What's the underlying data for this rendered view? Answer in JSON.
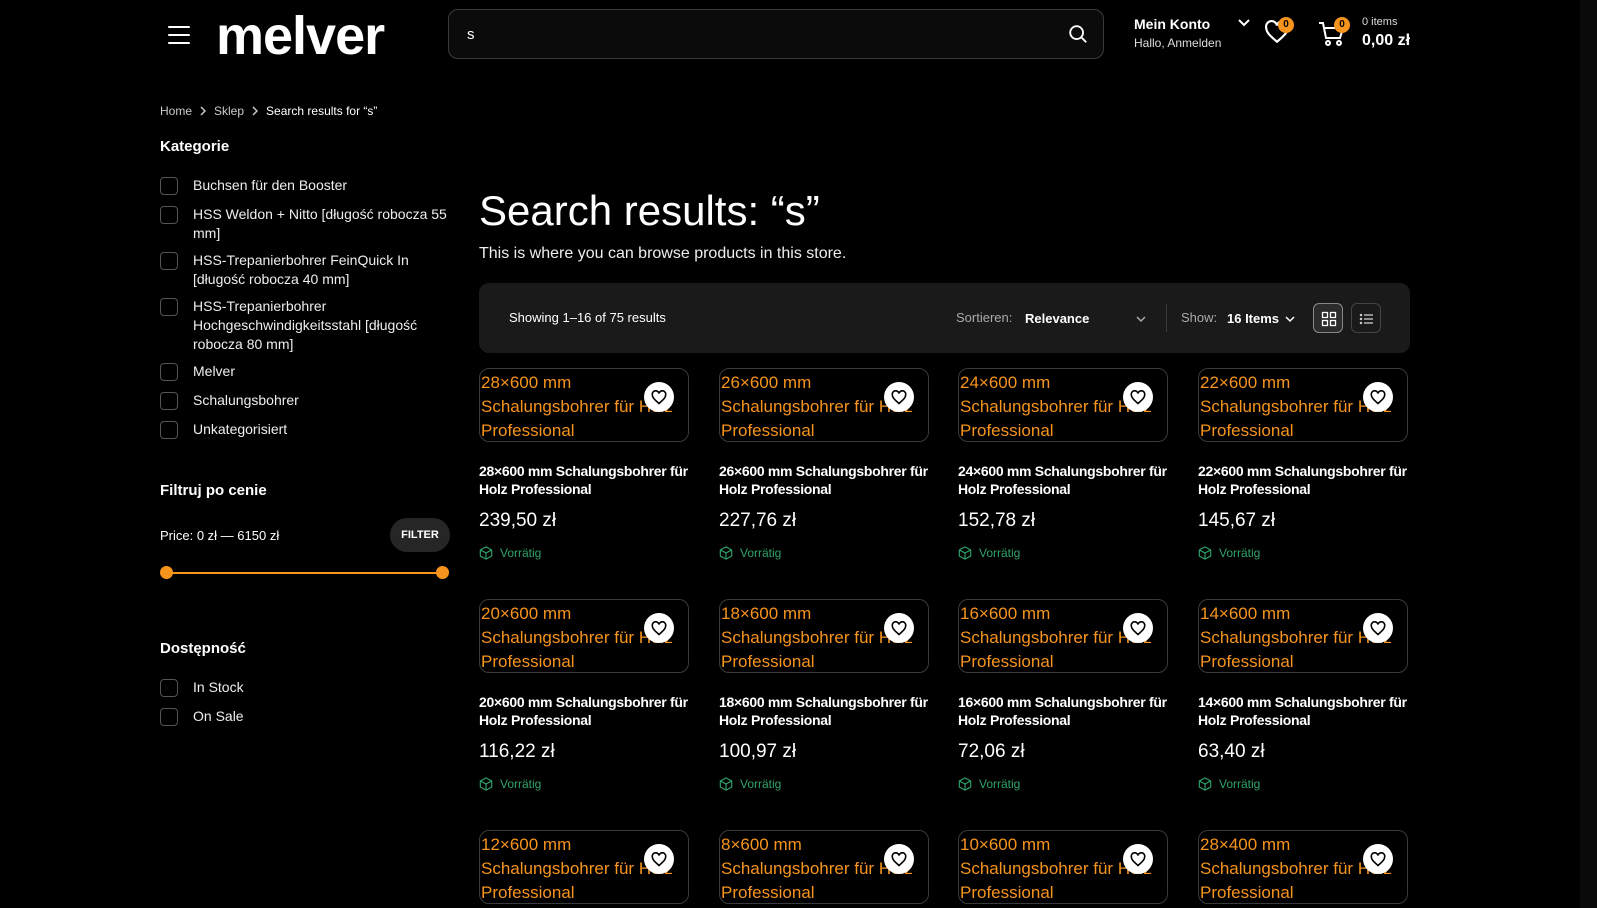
{
  "header": {
    "logo": "melver",
    "search_value": "s",
    "account_title": "Mein Konto",
    "account_sub": "Hallo, Anmelden",
    "wishlist_count": "0",
    "cart_count": "0",
    "cart_items": "0 items",
    "cart_total": "0,00 zł"
  },
  "breadcrumb": {
    "home": "Home",
    "shop": "Sklep",
    "current": "Search results for “s”"
  },
  "sidebar": {
    "categories_title": "Kategorie",
    "categories": [
      "Buchsen für den Booster",
      "HSS Weldon + Nitto [długość robocza 55 mm]",
      "HSS-Trepanierbohrer FeinQuick In [długość robocza 40 mm]",
      "HSS-Trepanierbohrer Hochgeschwindigkeitsstahl [długość robocza 80 mm]",
      "Melver",
      "Schalungsbohrer",
      "Unkategorisiert"
    ],
    "price_title": "Filtruj po cenie",
    "price_range": "Price: 0 zł — 6150 zł",
    "filter_label": "FILTER",
    "availability_title": "Dostępność",
    "availability": [
      "In Stock",
      "On Sale"
    ]
  },
  "main": {
    "title": "Search results: “s”",
    "subtitle": "This is where you can browse products in this store.",
    "result_count": "Showing 1–16 of 75 results",
    "sort_label": "Sortieren:",
    "sort_value": "Relevance",
    "show_label": "Show:",
    "show_value": "16 Items"
  },
  "products": [
    {
      "img_alt": "28×600 mm Schalungsbohrer für Holz Professional",
      "name": "28×600 mm Schalungsbohrer für Holz Professional",
      "price": "239,50 zł",
      "stock": "Vorrätig"
    },
    {
      "img_alt": "26×600 mm Schalungsbohrer für Holz Professional",
      "name": "26×600 mm Schalungsbohrer für Holz Professional",
      "price": "227,76 zł",
      "stock": "Vorrätig"
    },
    {
      "img_alt": "24×600 mm Schalungsbohrer für Holz Professional",
      "name": "24×600 mm Schalungsbohrer für Holz Professional",
      "price": "152,78 zł",
      "stock": "Vorrätig"
    },
    {
      "img_alt": "22×600 mm Schalungsbohrer für Holz Professional",
      "name": "22×600 mm Schalungsbohrer für Holz Professional",
      "price": "145,67 zł",
      "stock": "Vorrätig"
    },
    {
      "img_alt": "20×600 mm Schalungsbohrer für Holz Professional",
      "name": "20×600 mm Schalungsbohrer für Holz Professional",
      "price": "116,22 zł",
      "stock": "Vorrätig"
    },
    {
      "img_alt": "18×600 mm Schalungsbohrer für Holz Professional",
      "name": "18×600 mm Schalungsbohrer für Holz Professional",
      "price": "100,97 zł",
      "stock": "Vorrätig"
    },
    {
      "img_alt": "16×600 mm Schalungsbohrer für Holz Professional",
      "name": "16×600 mm Schalungsbohrer für Holz Professional",
      "price": "72,06 zł",
      "stock": "Vorrätig"
    },
    {
      "img_alt": "14×600 mm Schalungsbohrer für Holz Professional",
      "name": "14×600 mm Schalungsbohrer für Holz Professional",
      "price": "63,40 zł",
      "stock": "Vorrätig"
    },
    {
      "img_alt": "12×600 mm Schalungsbohrer für Holz Professional"
    },
    {
      "img_alt": "8×600 mm Schalungsbohrer für Holz Professional"
    },
    {
      "img_alt": "10×600 mm Schalungsbohrer für Holz Professional"
    },
    {
      "img_alt": "28×400 mm Schalungsbohrer für Holz Professional"
    }
  ],
  "colors": {
    "accent": "#f7941d",
    "stock": "#2fa36b",
    "background": "#000000",
    "panel": "#1a1a1a"
  }
}
